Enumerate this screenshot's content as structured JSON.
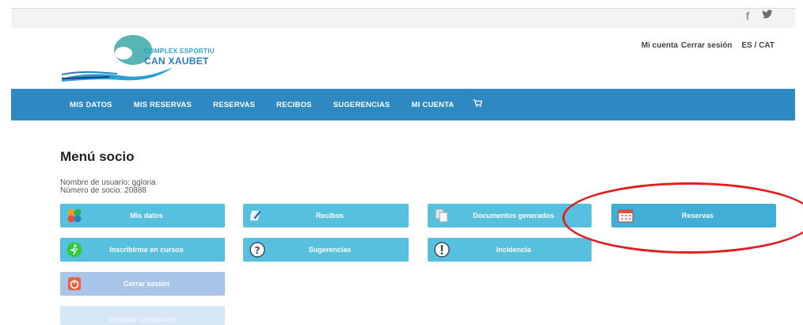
{
  "social": {
    "facebook_glyph": "f",
    "twitter_glyph": "🐦"
  },
  "brand": {
    "line1": "COMPLEX ESPORTIU",
    "line2": "CAN XAUBET",
    "accent": "#2a9fd6"
  },
  "account": {
    "my_account": "Mi cuenta",
    "logout": "Cerrar sesión",
    "language": "ES / CAT"
  },
  "nav": {
    "items": [
      "MIS DATOS",
      "MIS RESERVAS",
      "RESERVAS",
      "RECIBOS",
      "SUGERENCIAS",
      "MI CUENTA"
    ],
    "cart_icon": "cart-icon",
    "background": "#2e89c3"
  },
  "main": {
    "title": "Menú socio",
    "username_line": "Nombre de usuario: ggloria",
    "member_line": "Número de socio: 20888"
  },
  "tiles": {
    "mis_datos": {
      "label": "Mis datos",
      "icon": "users-icon"
    },
    "recibos": {
      "label": "Recibos",
      "icon": "pencil-icon"
    },
    "documentos": {
      "label": "Documentos generados",
      "icon": "documents-icon"
    },
    "reservas": {
      "label": "Reservas",
      "icon": "calendar-icon"
    },
    "inscribirme": {
      "label": "Inscribirme en cursos",
      "icon": "runner-icon"
    },
    "sugerencias": {
      "label": "Sugerencias",
      "icon": "question-icon"
    },
    "incidencia": {
      "label": "Incidencia",
      "icon": "alert-icon"
    },
    "cerrar": {
      "label": "Cerrar sesión",
      "icon": "power-icon"
    },
    "cambiar": {
      "label": "Cambiar contraseña"
    }
  },
  "colors": {
    "tile": "#58c0df",
    "tile_highlight": "#41aed6",
    "tile_logout": "#a9c6ea",
    "annotation_ring": "#e02020"
  }
}
